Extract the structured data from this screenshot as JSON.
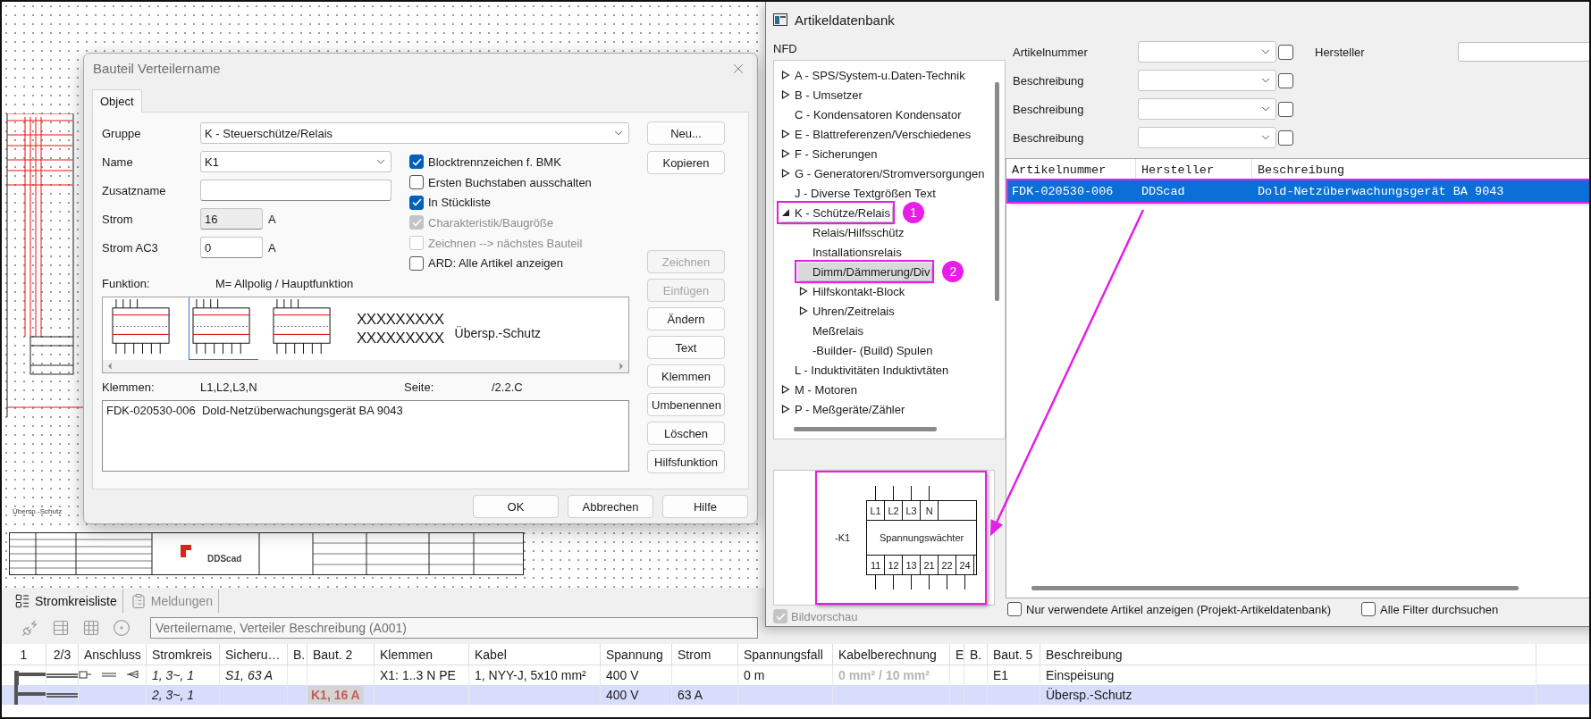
{
  "canvas": {
    "note": "Übersp.-Schutz",
    "logo": "DDScad"
  },
  "dialog": {
    "title": "Bauteil Verteilername",
    "tabs": [
      {
        "label": "Object",
        "selected": true
      }
    ],
    "group": {
      "label": "Gruppe",
      "value": "K - Steuerschütze/Relais"
    },
    "fields": [
      {
        "label": "Name",
        "value": "K1",
        "kind": "combo"
      },
      {
        "label": "Zusatzname",
        "kind": "text"
      },
      {
        "label": "Strom",
        "value": "16",
        "unit": "A",
        "kind": "readonly"
      },
      {
        "label": "Strom AC3",
        "value": "0",
        "unit": "A",
        "kind": "text"
      }
    ],
    "options": [
      {
        "label": "Blocktrennzeichen f. BMK",
        "checked": true,
        "disabled": false
      },
      {
        "label": "Ersten Buchstaben ausschalten",
        "checked": false,
        "disabled": false
      },
      {
        "label": "In Stückliste",
        "checked": true,
        "disabled": false
      },
      {
        "label": "Charakteristik/Baugröße",
        "checked": true,
        "disabled": true
      },
      {
        "label": "Zeichnen --> nächstes Bauteil",
        "checked": false,
        "disabled": true
      },
      {
        "label": "ARD: Alle Artikel anzeigen",
        "checked": false,
        "disabled": false
      }
    ],
    "top_buttons": [
      {
        "label": "Neu...",
        "disabled": false
      },
      {
        "label": "Kopieren",
        "disabled": false
      }
    ],
    "side_buttons": [
      {
        "label": "Zeichnen",
        "disabled": true
      },
      {
        "label": "Einfügen",
        "disabled": true
      },
      {
        "label": "Ändern",
        "disabled": false
      },
      {
        "label": "Text",
        "disabled": false
      },
      {
        "label": "Klemmen",
        "disabled": false
      },
      {
        "label": "Umbenennen",
        "disabled": false
      },
      {
        "label": "Löschen",
        "disabled": false
      },
      {
        "label": "Hilfsfunktion",
        "disabled": false
      }
    ],
    "funktion": {
      "label": "Funktion:",
      "value": "M= Allpolig / Hauptfunktion"
    },
    "symbols": [
      {
        "selected": false
      },
      {
        "selected": true
      },
      {
        "selected": false
      }
    ],
    "symbol_texts": [
      "XXXXXXXXX",
      "XXXXXXXXX"
    ],
    "symbol_caption": "Übersp.-Schutz",
    "klemmen": {
      "label": "Klemmen:",
      "value": "L1,L2,L3,N"
    },
    "seite": {
      "label": "Seite:",
      "value": "/2.2.C"
    },
    "article_lines": [
      "FDK-020530-006  Dold-Netzüberwachungsgerät BA 9043"
    ],
    "footer_buttons": [
      "OK",
      "Abbrechen",
      "Hilfe"
    ]
  },
  "article_db": {
    "title": "Artikeldatenbank",
    "tree_label": "NFD",
    "tree": [
      {
        "label": "A - SPS/System-u.Daten-Technik",
        "expandable": true,
        "expanded": false,
        "selected": false
      },
      {
        "label": "B - Umsetzer",
        "expandable": true,
        "expanded": false,
        "selected": false
      },
      {
        "label": "C - Kondensatoren Kondensator",
        "expandable": false,
        "expanded": false,
        "selected": false
      },
      {
        "label": "E - Blattreferenzen/Verschiedenes",
        "expandable": true,
        "expanded": false,
        "selected": false
      },
      {
        "label": "F - Sicherungen",
        "expandable": true,
        "expanded": false,
        "selected": false
      },
      {
        "label": "G - Generatoren/Stromversorgungen",
        "expandable": true,
        "expanded": false,
        "selected": false
      },
      {
        "label": "J - Diverse Textgrößen Text",
        "expandable": false,
        "expanded": false,
        "selected": false
      },
      {
        "label": "K - Schütze/Relais",
        "expandable": true,
        "expanded": true,
        "selected": false,
        "callout": "1",
        "children": [
          {
            "label": "Relais/Hilfsschütz",
            "expandable": false,
            "expanded": false,
            "selected": false
          },
          {
            "label": "Installationsrelais",
            "expandable": false,
            "expanded": false,
            "selected": false
          },
          {
            "label": "Dimm/Dämmerung/Div",
            "expandable": false,
            "expanded": false,
            "selected": true,
            "callout": "2"
          },
          {
            "label": "Hilfskontakt-Block",
            "expandable": true,
            "expanded": false,
            "selected": false
          },
          {
            "label": "Uhren/Zeitrelais",
            "expandable": true,
            "expanded": false,
            "selected": false
          },
          {
            "label": "Meßrelais",
            "expandable": false,
            "expanded": false,
            "selected": false
          },
          {
            "label": "-Builder- (Build) Spulen",
            "expandable": false,
            "expanded": false,
            "selected": false
          }
        ]
      },
      {
        "label": "L - Induktivitäten Induktivtäten",
        "expandable": false,
        "expanded": false,
        "selected": false
      },
      {
        "label": "M - Motoren",
        "expandable": true,
        "expanded": false,
        "selected": false
      },
      {
        "label": "P - Meßgeräte/Zähler",
        "expandable": true,
        "expanded": false,
        "selected": false
      }
    ],
    "filters": [
      {
        "label": "Artikelnummer",
        "checked": false
      },
      {
        "label": "Beschreibung",
        "checked": false
      },
      {
        "label": "Beschreibung",
        "checked": false
      },
      {
        "label": "Beschreibung",
        "checked": false
      }
    ],
    "manufacturer": {
      "label": "Hersteller"
    },
    "table": {
      "columns": [
        "Artikelnummer",
        "Hersteller",
        "Beschreibung"
      ],
      "rows": [
        {
          "cells": [
            "FDK-020530-006",
            "DDScad",
            "Dold-Netzüberwachungsgerät BA 9043"
          ],
          "selected": true,
          "highlighted": true
        }
      ]
    },
    "preview": {
      "designation": "-K1",
      "name": "Spannungswächter",
      "top_terminals": [
        "L1",
        "L2",
        "L3",
        "N"
      ],
      "bottom_terminals": [
        "11",
        "12",
        "13",
        "21",
        "22",
        "24"
      ],
      "highlighted": true
    },
    "preview_toggle": {
      "label": "Bildvorschau",
      "checked": true,
      "disabled": true
    },
    "bottom_options": [
      {
        "label": "Nur verwendete Artikel anzeigen (Projekt-Artikeldatenbank)",
        "checked": false
      },
      {
        "label": "Alle Filter durchsuchen",
        "checked": false
      }
    ]
  },
  "bottom": {
    "tabs": [
      {
        "label": "Stromkreisliste",
        "selected": true
      },
      {
        "label": "Meldungen",
        "selected": false
      }
    ],
    "path": "Verteilername, Verteiler Beschreibung (A001)",
    "columns": [
      "1",
      "2/3",
      "Anschluss",
      "Stromkreis",
      "Sicheru…",
      "B.",
      "Baut. 2",
      "Klemmen",
      "Kabel",
      "Spannung",
      "Strom",
      "Spannungsfall",
      "Kabelberechnung",
      "E",
      "B.",
      "Baut. 5",
      "Beschreibung"
    ],
    "rows": [
      {
        "kind": "feed",
        "selected": false,
        "cells": [
          null,
          null,
          null,
          "1, 3~, 1",
          "S1, 63 A",
          null,
          null,
          "X1: 1..3 N PE",
          "1, NYY-J, 5x10 mm²",
          "400 V",
          null,
          "0 m",
          "0 mm² / 10 mm²",
          null,
          null,
          "E1",
          "Einspeisung"
        ]
      },
      {
        "kind": "branch",
        "selected": true,
        "cells": [
          null,
          null,
          null,
          "2, 3~, 1",
          null,
          null,
          "K1, 16 A",
          null,
          null,
          "400 V",
          "63 A",
          null,
          null,
          null,
          null,
          null,
          "Übersp.-Schutz"
        ]
      }
    ]
  }
}
